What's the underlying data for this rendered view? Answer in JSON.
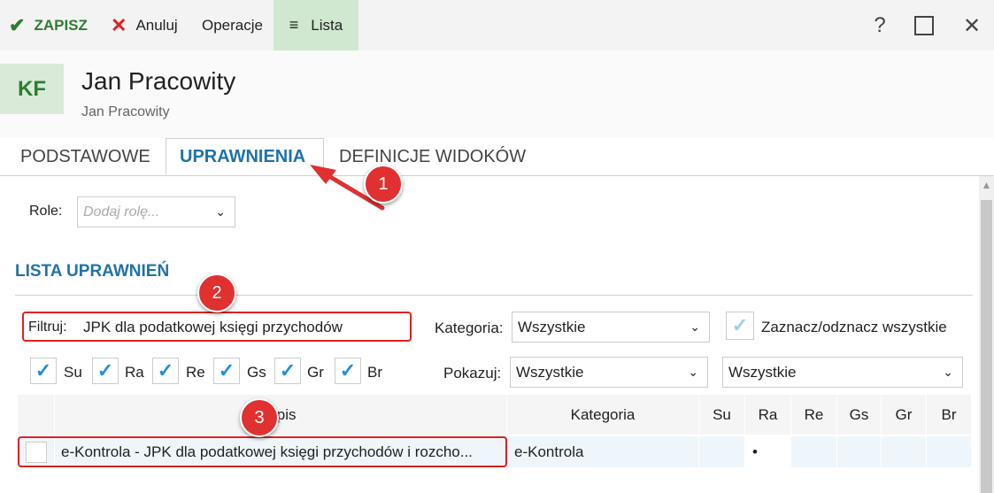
{
  "toolbar": {
    "save_label": "ZAPISZ",
    "cancel_label": "Anuluj",
    "operations_label": "Operacje",
    "list_label": "Lista"
  },
  "header": {
    "avatar_initials": "KF",
    "name": "Jan Pracowity",
    "subname": "Jan Pracowity"
  },
  "tabs": [
    {
      "label": "PODSTAWOWE"
    },
    {
      "label": "UPRAWNIENIA"
    },
    {
      "label": "DEFINICJE WIDOKÓW"
    }
  ],
  "roles": {
    "label": "Role:",
    "placeholder": "Dodaj rolę..."
  },
  "section_title": "LISTA UPRAWNIEŃ",
  "filter": {
    "label": "Filtruj:",
    "value": "JPK dla podatkowej księgi przychodów"
  },
  "category": {
    "label": "Kategoria:",
    "value": "Wszystkie"
  },
  "select_all_label": "Zaznacz/odznacz wszystkie",
  "checkboxes": [
    {
      "label": "Su",
      "checked": true
    },
    {
      "label": "Ra",
      "checked": true
    },
    {
      "label": "Re",
      "checked": true
    },
    {
      "label": "Gs",
      "checked": true
    },
    {
      "label": "Gr",
      "checked": true
    },
    {
      "label": "Br",
      "checked": true
    }
  ],
  "show": {
    "label": "Pokazuj:",
    "value1": "Wszystkie",
    "value2": "Wszystkie"
  },
  "table": {
    "headers": [
      "Opis",
      "Kategoria",
      "Su",
      "Ra",
      "Re",
      "Gs",
      "Gr",
      "Br"
    ],
    "rows": [
      {
        "opis": "e-Kontrola - JPK dla podatkowej księgi przychodów i rozcho...",
        "kategoria": "e-Kontrola",
        "su": "",
        "ra": "•",
        "re": "",
        "gs": "",
        "gr": "",
        "br": ""
      }
    ]
  },
  "annotations": [
    "1",
    "2",
    "3"
  ],
  "colors": {
    "accent": "#1e73a8",
    "save_green": "#2e7d32",
    "annotation_red": "#e03030",
    "check_blue": "#1e90d6"
  }
}
